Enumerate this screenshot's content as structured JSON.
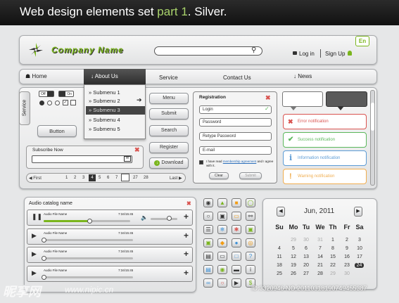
{
  "banner": {
    "title_prefix": "Web design elements set ",
    "title_accent": "part 1",
    "title_suffix": ". Silver."
  },
  "header": {
    "company": "Company Name",
    "lang": "En",
    "login": "Log in",
    "signup": "Sign Up"
  },
  "nav": {
    "items": [
      "Home",
      "About Us",
      "Service",
      "Contact Us",
      "News"
    ]
  },
  "dropdown": {
    "items": [
      "Submenu 1",
      "Submenu 2",
      "Submenu 3",
      "Submenu 4",
      "Submenu 5"
    ]
  },
  "side_tab": "Service",
  "toggles": {
    "off": "Off",
    "on": "On"
  },
  "button_label": "Button",
  "menu_buttons": [
    "Menu",
    "Submit",
    "Search",
    "Register",
    "Download"
  ],
  "subscribe": {
    "label": "Subscribe Now"
  },
  "pagination": {
    "first": "First",
    "pages": [
      "1",
      "2",
      "3",
      "4",
      "5",
      "6",
      "7",
      "27",
      "28"
    ],
    "active": "4",
    "last": "Last"
  },
  "registration": {
    "title": "Registration",
    "fields": [
      "Login",
      "Password",
      "Retype Password",
      "E-mail"
    ],
    "agree_prefix": "I have read ",
    "agree_link": "membership agreement",
    "agree_suffix": " and I agree with it.",
    "clear": "Clear",
    "submit": "Submit"
  },
  "notifications": [
    {
      "text": "Error notification",
      "color": "#d9534f",
      "icon": "x-icon"
    },
    {
      "text": "Success notification",
      "color": "#5cb85c",
      "icon": "check-icon"
    },
    {
      "text": "Information notification",
      "color": "#5b9bd5",
      "icon": "info-icon"
    },
    {
      "text": "Warning notification",
      "color": "#f0ad4e",
      "icon": "warning-icon"
    }
  ],
  "audio": {
    "title": "Audio catalog name",
    "tracks": [
      {
        "name": "Audio File Name",
        "time": "7:34/15:45",
        "progress": 0.53
      },
      {
        "name": "Audio File Name",
        "time": "7:34/15:45",
        "progress": 0.0
      },
      {
        "name": "Audio File Name",
        "time": "7:34/15:45",
        "progress": 0.0
      },
      {
        "name": "Audio File Name",
        "time": "7:34/15:45",
        "progress": 0.0
      }
    ]
  },
  "calendar": {
    "month": "Jun, 2011",
    "days": [
      "Su",
      "Mo",
      "Tu",
      "We",
      "Th",
      "Fr",
      "Sa"
    ],
    "dates": [
      "29",
      "30",
      "31",
      "1",
      "2",
      "3",
      "4",
      "5",
      "6",
      "7",
      "8",
      "9",
      "10",
      "11",
      "12",
      "13",
      "14",
      "15",
      "16",
      "17",
      "18",
      "19",
      "20",
      "21",
      "22",
      "23",
      "24",
      "25",
      "26",
      "27",
      "28",
      "29",
      "30"
    ],
    "today": "24"
  },
  "icons": [
    "camera-icon",
    "chat-icon",
    "folder-icon",
    "globe-icon",
    "cd-icon",
    "save-icon",
    "box-icon",
    "mic-icon",
    "equalizer-icon",
    "snowflake-icon",
    "star-icon",
    "cart-icon",
    "photo-icon",
    "shield-icon",
    "tag-icon",
    "rss-icon",
    "trash-icon",
    "clipboard-icon",
    "window-icon",
    "question-icon",
    "printer-icon",
    "eye-icon",
    "gamepad-icon",
    "info-icon",
    "glasses-icon",
    "record-icon",
    "play-icon",
    "dollar-icon"
  ],
  "watermark": {
    "brand": "昵享网",
    "url": "www.nipic.cn",
    "id": "ID:3320946 NO:20110318190749455387"
  }
}
